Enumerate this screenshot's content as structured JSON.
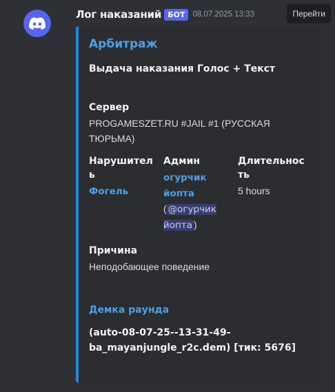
{
  "message": {
    "username": "Лог наказаний",
    "bot_badge": "БОТ",
    "timestamp": "08.07.2025 13:33",
    "jump_label": "Перейти",
    "avatar_icon": "discord-logo-icon",
    "colors": {
      "accent": "#5865f2",
      "embed_border": "#1e88e5",
      "link": "#4f9ee8"
    }
  },
  "embed": {
    "title": "Арбитраж",
    "description": "Выдача наказания Голос + Текст",
    "server": {
      "name": "Сервер",
      "value": "PROGAMESZET.RU #JAIL #1 (РУССКАЯ ТЮРЬМА)"
    },
    "violator": {
      "name": "Нарушитель",
      "value": "Фогель"
    },
    "admin": {
      "name": "Админ",
      "value": "огурчик йопта",
      "paren_open": "(",
      "mention": "@огурчик йопта",
      "paren_close": ")"
    },
    "duration": {
      "name": "Длительность",
      "value": "5 hours"
    },
    "reason": {
      "name": "Причина",
      "value": "Неподобающее поведение"
    },
    "demo": {
      "name": "Демка раунда",
      "value": "(auto-08-07-25--13-31-49-ba_mayanjungle_r2c.dem) [тик: 5676]"
    }
  }
}
